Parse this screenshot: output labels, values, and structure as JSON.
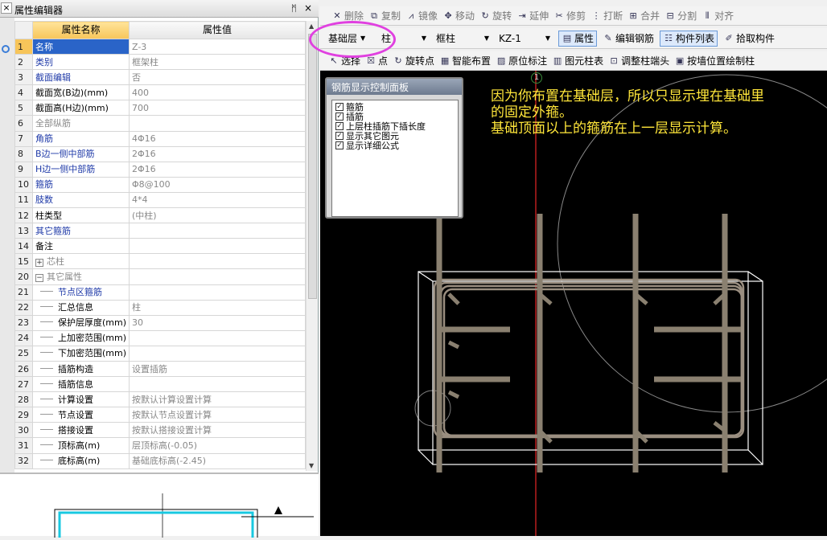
{
  "panel": {
    "title": "属性编辑器",
    "pin": "ᛗ",
    "close": "×",
    "header_name": "属性名称",
    "header_value": "属性值"
  },
  "rows": [
    {
      "n": "1",
      "name": "名称",
      "value": "Z-3",
      "nc": "sel",
      "vc": "vl"
    },
    {
      "n": "2",
      "name": "类别",
      "value": "框架柱",
      "nc": "blue",
      "vc": "vl"
    },
    {
      "n": "3",
      "name": "截面编辑",
      "value": "否",
      "nc": "blue",
      "vc": "vl"
    },
    {
      "n": "4",
      "name": "截面宽(B边)(mm)",
      "value": "400",
      "nc": "blk",
      "vc": "vl"
    },
    {
      "n": "5",
      "name": "截面高(H边)(mm)",
      "value": "700",
      "nc": "blk",
      "vc": "vl"
    },
    {
      "n": "6",
      "name": "全部纵筋",
      "value": "",
      "nc": "gray",
      "vc": "vl"
    },
    {
      "n": "7",
      "name": "角筋",
      "value": "4Φ16",
      "nc": "blue",
      "vc": "vl"
    },
    {
      "n": "8",
      "name": "B边一侧中部筋",
      "value": "2Φ16",
      "nc": "blue",
      "vc": "vl"
    },
    {
      "n": "9",
      "name": "H边一侧中部筋",
      "value": "2Φ16",
      "nc": "blue",
      "vc": "vl"
    },
    {
      "n": "10",
      "name": "箍筋",
      "value": "Φ8@100",
      "nc": "blue",
      "vc": "vl"
    },
    {
      "n": "11",
      "name": "肢数",
      "value": "4*4",
      "nc": "blue",
      "vc": "vl"
    },
    {
      "n": "12",
      "name": "柱类型",
      "value": "(中柱)",
      "nc": "blk",
      "vc": "vl"
    },
    {
      "n": "13",
      "name": "其它箍筋",
      "value": "",
      "nc": "blue",
      "vc": "vl"
    },
    {
      "n": "14",
      "name": "备注",
      "value": "",
      "nc": "blk",
      "vc": "vl"
    },
    {
      "n": "15",
      "name": "芯柱",
      "value": "",
      "nc": "gray",
      "vc": "vl",
      "exp": "+"
    },
    {
      "n": "20",
      "name": "其它属性",
      "value": "",
      "nc": "gray",
      "vc": "vl",
      "exp": "−"
    },
    {
      "n": "21",
      "name": "节点区箍筋",
      "value": "",
      "nc": "blue",
      "vc": "vl",
      "ind": true
    },
    {
      "n": "22",
      "name": "汇总信息",
      "value": "柱",
      "nc": "blk",
      "vc": "vl",
      "ind": true
    },
    {
      "n": "23",
      "name": "保护层厚度(mm)",
      "value": "30",
      "nc": "blk",
      "vc": "vl",
      "ind": true
    },
    {
      "n": "24",
      "name": "上加密范围(mm)",
      "value": "",
      "nc": "blk",
      "vc": "vl",
      "ind": true
    },
    {
      "n": "25",
      "name": "下加密范围(mm)",
      "value": "",
      "nc": "blk",
      "vc": "vl",
      "ind": true
    },
    {
      "n": "26",
      "name": "插筋构造",
      "value": "设置插筋",
      "nc": "blk",
      "vc": "vl",
      "ind": true
    },
    {
      "n": "27",
      "name": "插筋信息",
      "value": "",
      "nc": "blk",
      "vc": "vl",
      "ind": true
    },
    {
      "n": "28",
      "name": "计算设置",
      "value": "按默认计算设置计算",
      "nc": "blk",
      "vc": "vl",
      "ind": true
    },
    {
      "n": "29",
      "name": "节点设置",
      "value": "按默认节点设置计算",
      "nc": "blk",
      "vc": "vl",
      "ind": true
    },
    {
      "n": "30",
      "name": "搭接设置",
      "value": "按默认搭接设置计算",
      "nc": "blk",
      "vc": "vl",
      "ind": true
    },
    {
      "n": "31",
      "name": "顶标高(m)",
      "value": "层顶标高(-0.05)",
      "nc": "blk",
      "vc": "vl",
      "ind": true
    },
    {
      "n": "32",
      "name": "底标高(m)",
      "value": "基础底标高(-2.45)",
      "nc": "blk",
      "vc": "vl",
      "ind": true
    }
  ],
  "toolbar1": [
    "删除",
    "复制",
    "镜像",
    "移动",
    "旋转",
    "延伸",
    "修剪",
    "打断",
    "合并",
    "分割",
    "对齐"
  ],
  "toolbar2": {
    "floor": "基础层",
    "type": "柱",
    "subtype": "框柱",
    "element": "KZ-1",
    "attr": "属性",
    "edit_rebar": "编辑钢筋",
    "list": "构件列表",
    "pick": "拾取构件"
  },
  "toolbar3": [
    "选择",
    "点",
    "旋转点",
    "智能布置",
    "原位标注",
    "图元柱表",
    "调整柱端头",
    "按墙位置绘制柱"
  ],
  "control_panel": {
    "title": "钢筋显示控制面板",
    "items": [
      "箍筋",
      "插筋",
      "上层柱插筋下插长度",
      "显示其它图元",
      "显示详细公式"
    ]
  },
  "axis_label": "1",
  "note": {
    "line1": "因为你布置在基础层，所以只显示埋在基础里",
    "line2": "的固定外箍。",
    "line3": "基础顶面以上的箍筋在上一层显示计算。"
  },
  "colors": {
    "annotation": "#ffe63a",
    "highlight_ellipse": "#e040e0",
    "axis": "#c62020"
  }
}
